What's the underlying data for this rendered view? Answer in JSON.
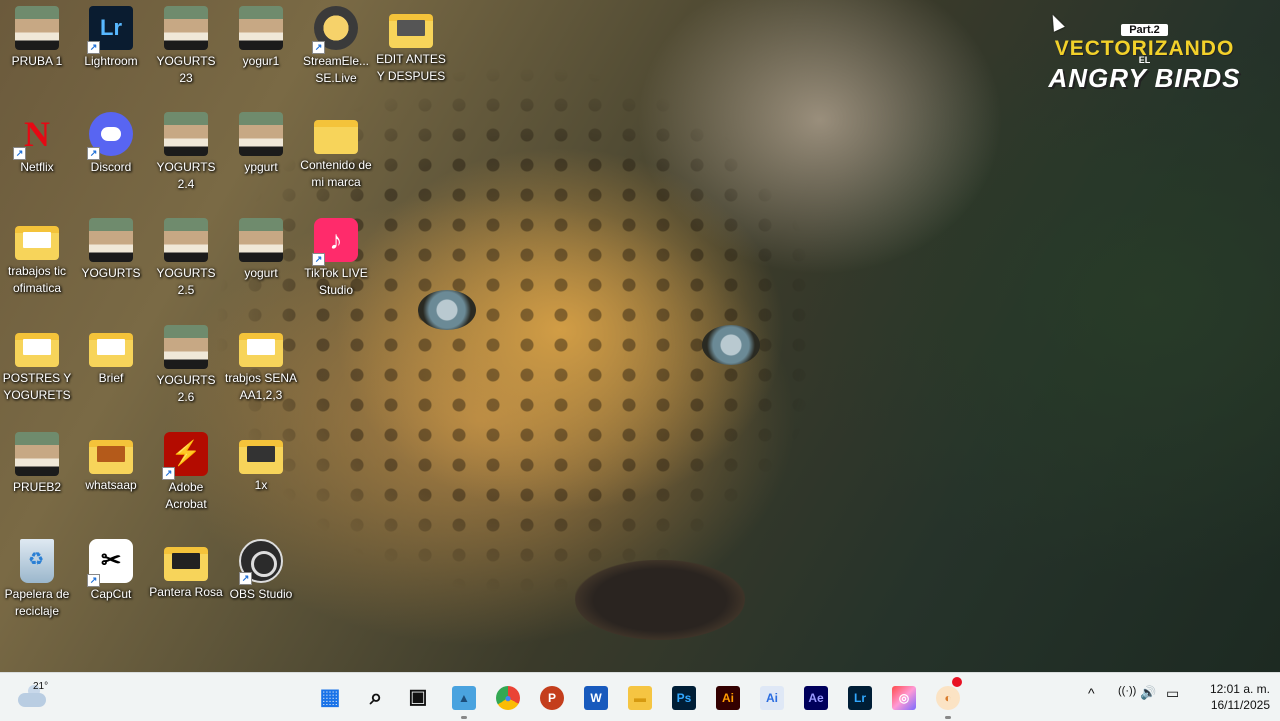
{
  "desktop": {
    "icons": [
      {
        "label": "PRUBA 1",
        "icon": "video-thumbnail-icon"
      },
      {
        "label": "Lightroom",
        "icon": "lightroom-icon"
      },
      {
        "label": "YOGURTS 23",
        "icon": "video-thumbnail-icon"
      },
      {
        "label": "yogur1",
        "icon": "video-thumbnail-icon"
      },
      {
        "label": "StreamEle... SE.Live",
        "icon": "streamelements-icon"
      },
      {
        "label": "EDIT ANTES Y DESPUES",
        "icon": "folder-icon"
      },
      {
        "label": "Netflix",
        "icon": "netflix-icon"
      },
      {
        "label": "Discord",
        "icon": "discord-icon"
      },
      {
        "label": "YOGURTS 2.4",
        "icon": "video-thumbnail-icon"
      },
      {
        "label": "ypgurt",
        "icon": "video-thumbnail-icon"
      },
      {
        "label": "Contenido de mi marca",
        "icon": "folder-icon"
      },
      {
        "label": "trabajos tic ofimatica",
        "icon": "folder-icon"
      },
      {
        "label": "YOGURTS",
        "icon": "video-thumbnail-icon"
      },
      {
        "label": "YOGURTS 2.5",
        "icon": "video-thumbnail-icon"
      },
      {
        "label": "yogurt",
        "icon": "video-thumbnail-icon"
      },
      {
        "label": "TikTok LIVE Studio",
        "icon": "tiktok-icon"
      },
      {
        "label": "POSTRES Y YOGURETS",
        "icon": "folder-icon"
      },
      {
        "label": "Brief",
        "icon": "folder-icon"
      },
      {
        "label": "YOGURTS 2.6",
        "icon": "video-thumbnail-icon"
      },
      {
        "label": "trabjos SENA AA1,2,3",
        "icon": "folder-icon"
      },
      {
        "label": "PRUEB2",
        "icon": "video-thumbnail-icon"
      },
      {
        "label": "whatsaap",
        "icon": "folder-icon"
      },
      {
        "label": "Adobe Acrobat",
        "icon": "acrobat-icon"
      },
      {
        "label": "1x",
        "icon": "folder-icon"
      },
      {
        "label": "Papelera de reciclaje",
        "icon": "recycle-bin-icon"
      },
      {
        "label": "CapCut",
        "icon": "capcut-icon"
      },
      {
        "label": "Pantera Rosa",
        "icon": "folder-icon"
      },
      {
        "label": "OBS Studio",
        "icon": "obs-icon"
      }
    ]
  },
  "overlay": {
    "part": "Part.2",
    "line1": "VECTORIZANDO",
    "small": "EL",
    "line2": "ANGRY BIRDS"
  },
  "taskbar": {
    "weather_temp": "21°",
    "apps": [
      {
        "name": "start",
        "glyph": "▦"
      },
      {
        "name": "search",
        "glyph": "⌕"
      },
      {
        "name": "task-view",
        "glyph": "▣"
      },
      {
        "name": "photos",
        "glyph": "▲"
      },
      {
        "name": "chrome",
        "glyph": "●"
      },
      {
        "name": "powerpoint",
        "glyph": "P"
      },
      {
        "name": "word",
        "glyph": "W"
      },
      {
        "name": "file-explorer",
        "glyph": "▬"
      },
      {
        "name": "photoshop",
        "glyph": "Ps"
      },
      {
        "name": "illustrator",
        "glyph": "Ai"
      },
      {
        "name": "illustrator-alt",
        "glyph": "Ai"
      },
      {
        "name": "after-effects",
        "glyph": "Ae"
      },
      {
        "name": "lightroom",
        "glyph": "Lr"
      },
      {
        "name": "creative-cloud",
        "glyph": "◎"
      },
      {
        "name": "paint",
        "glyph": "◐"
      }
    ],
    "tray": {
      "chevron": "^",
      "wifi": "((·))",
      "volume": "🔊",
      "battery": "▭"
    },
    "time": "12:01 a. m.",
    "date": "16/11/2025"
  }
}
